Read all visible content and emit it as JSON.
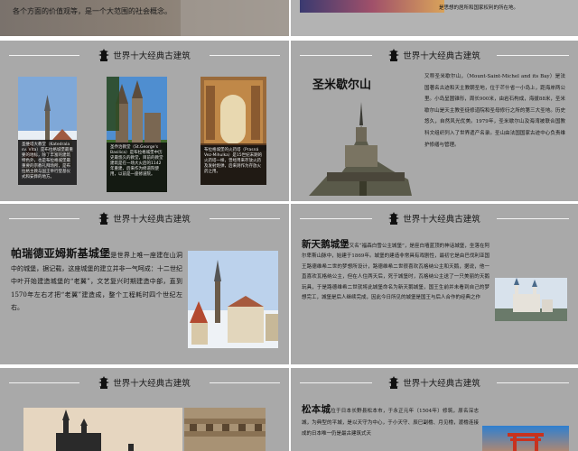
{
  "header_text": "世界十大经典古建筑",
  "top_left": {
    "line": "各个方面的价值观等，是一个大范围的社会概念。"
  },
  "top_right": {
    "line": "是思想的居所和国家权利的所在地。"
  },
  "slide1": {
    "captions": [
      "圣维塔大教堂（Katedrala sv. Víta）是布拉格城堡最重要的地标，除了丰富的建筑特色外，也是布拉格城堡最重要的宗教礼拜场所，是布拉格主教与国王举行登基仪式和安葬的地方。",
      "圣乔治教堂（St.George's Basilica）是布拉格城堡中历史最悠久的教堂，目前的教堂建筑是在一场大火后的1142年重建，后来作为修道院使用，以前是一座修道院。",
      "布拉格城堡的火药塔（Prasná Vez-Mihulka）是15世纪末期的火药塔一样，曾经用来存放火药及发射炮弹，后来则作为存放火药之用。"
    ]
  },
  "slide2": {
    "title": "圣米歇尔山",
    "paragraph": "又称圣米歇尔山，（Mount-Saint-Michel and its Bay）是法国著名古迹和天主教朝圣地，位于芒什省一小岛上，距海岸两公里。小岛呈圆锥形，周长900米，由岩石构成，海拔88米，圣米歇尔山是天主教圣徒修道院和圣母修行之所的第三大圣地。历史悠久，自然风光优美。1979年，圣米歇尔山及海湾被联合国教科文组织列入了世界遗产名录。圣山由法国国家古迹中心负责维护修缮与管理。"
  },
  "slide3": {
    "title": "帕瑞德亚姆斯基城堡",
    "paragraph": "是世界上唯一座建在山洞中的城堡，据记载，这座城堡的建立并非一气呵成：十二世纪中叶开始建造城堡的“老翼”，文艺复兴时期建造中部，直到1570年左右才把“老翼”建造成，整个工程耗时四个世纪左右。"
  },
  "slide4": {
    "title": "新天鹅城堡",
    "paragraph": "又名“福森白雪公主城堡”，是座白墙蓝顶的神话城堡，坐落在阿尔卑斯山脉中，始建于1869年。城堡的建造非常具有戏剧性，最初它是由巴伐利亚国王路德维希二世的梦想所设计，路德维希二世很喜欢瓦格纳公主和天鹅，据说，他一直喜欢瓦格纳公主，但在人住两天后，死于城堡时，瓦格纳公主送了一只美丽的天鹅玩具，于是路德维希二世就将此城堡命名为新天鹅城堡，国王生前并未看到自己的梦想完工，城堡是后人继续完成，因此今日所见的城堡是国王与后人合作的经典之作"
  },
  "slide6": {
    "title": "松本城",
    "paragraph": "位于日本长野县松本市，于永正元年（1504年）修筑，原名深志城，为典型的平城，是以天守为中心，于小天守、辰巳副橹、月见橹，渡橹连接成的日本唯一仍是最古建筑式天"
  },
  "colors": {
    "slide_bg": "#a9a9a9",
    "page_bg": "#ffffff",
    "caption_bg": "#141414"
  }
}
